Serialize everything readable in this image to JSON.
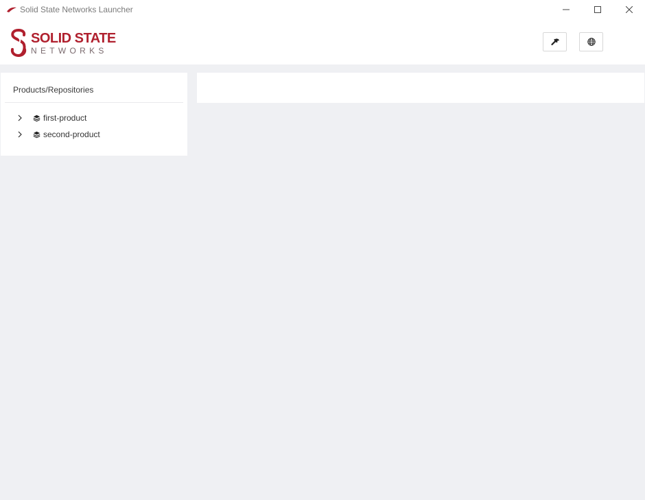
{
  "window": {
    "title": "Solid State Networks Launcher"
  },
  "brand": {
    "line1": "SOLID STATE",
    "line2": "NETWORKS",
    "color": "#b0202e"
  },
  "header": {
    "settings_icon": "wrench-icon",
    "language_icon": "globe-icon"
  },
  "sidebar": {
    "heading": "Products/Repositories",
    "items": [
      {
        "label": "first-product",
        "icon": "layers-icon",
        "expander": "chevron-right-icon"
      },
      {
        "label": "second-product",
        "icon": "layers-icon",
        "expander": "chevron-right-icon"
      }
    ]
  },
  "colors": {
    "background": "#eff0f3",
    "panel": "#ffffff",
    "accent": "#b0202e"
  }
}
